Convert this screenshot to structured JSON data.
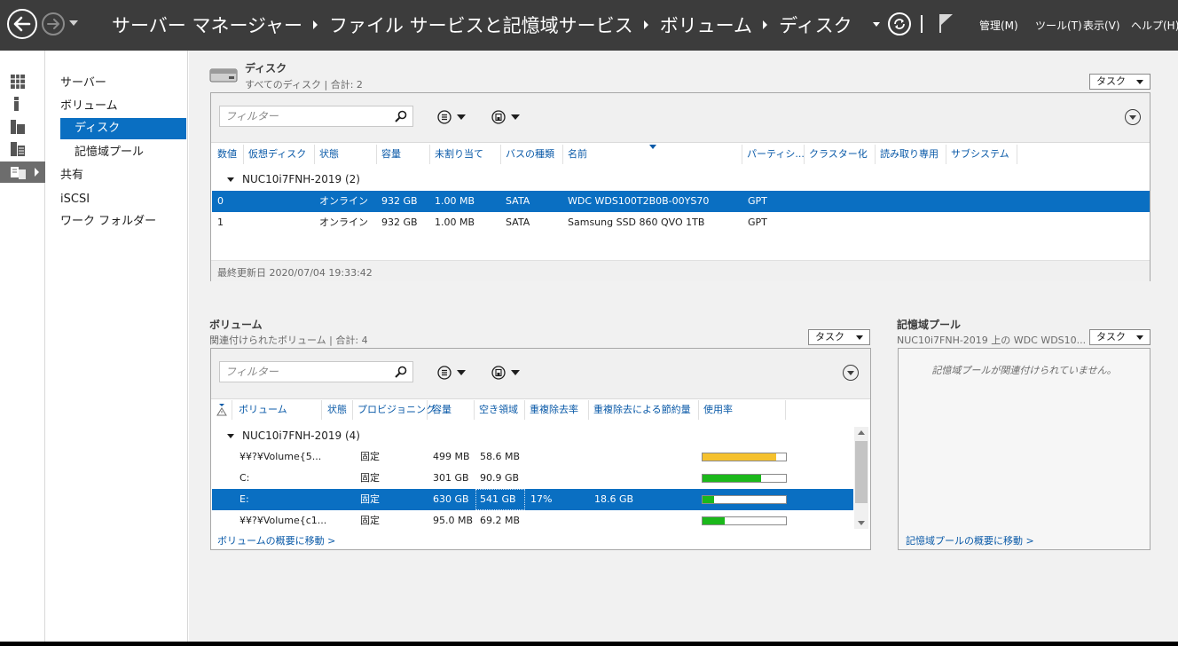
{
  "header": {
    "breadcrumbs": [
      "サーバー マネージャー",
      "ファイル サービスと記憶域サービス",
      "ボリューム",
      "ディスク"
    ],
    "menus": [
      "管理(M)",
      "ツール(T)",
      "表示(V)",
      "ヘルプ(H)"
    ]
  },
  "tree": {
    "items": [
      "サーバー",
      "ボリューム",
      "ディスク",
      "記憶域プール",
      "共有",
      "iSCSI",
      "ワーク フォルダー"
    ]
  },
  "disks": {
    "title": "ディスク",
    "subtitle": "すべてのディスク | 合計: 2",
    "task_label": "タスク",
    "filter_placeholder": "フィルター",
    "columns": [
      "数値",
      "仮想ディスク",
      "状態",
      "容量",
      "未割り当て",
      "バスの種類",
      "名前",
      "パーティシ...",
      "クラスター化",
      "読み取り専用",
      "サブシステム"
    ],
    "group_label": "NUC10i7FNH-2019 (2)",
    "rows": [
      {
        "num": "0",
        "virtual": "",
        "state": "オンライン",
        "capacity": "932 GB",
        "unalloc": "1.00 MB",
        "bus": "SATA",
        "name": "WDC  WDS100T2B0B-00YS70",
        "partition": "GPT"
      },
      {
        "num": "1",
        "virtual": "",
        "state": "オンライン",
        "capacity": "932 GB",
        "unalloc": "1.00 MB",
        "bus": "SATA",
        "name": "Samsung SSD 860 QVO 1TB",
        "partition": "GPT"
      }
    ],
    "footer": "最終更新日 2020/07/04 19:33:42"
  },
  "volumes": {
    "title": "ボリューム",
    "subtitle": "関連付けられたボリューム | 合計: 4",
    "task_label": "タスク",
    "filter_placeholder": "フィルター",
    "columns": [
      "ボリューム",
      "状態",
      "プロビジョニング",
      "容量",
      "空き領域",
      "重複除去率",
      "重複除去による節約量",
      "使用率"
    ],
    "group_label": "NUC10i7FNH-2019 (4)",
    "rows": [
      {
        "volume": "¥¥?¥Volume{5...",
        "state": "",
        "provisioning": "固定",
        "capacity": "499 MB",
        "free": "58.6 MB",
        "dedup_rate": "",
        "dedup_saved": "",
        "usage": 0.88,
        "usage_color": "#f5c12e"
      },
      {
        "volume": "C:",
        "state": "",
        "provisioning": "固定",
        "capacity": "301 GB",
        "free": "90.9 GB",
        "dedup_rate": "",
        "dedup_saved": "",
        "usage": 0.7,
        "usage_color": "#1bb81b"
      },
      {
        "volume": "E:",
        "state": "",
        "provisioning": "固定",
        "capacity": "630 GB",
        "free": "541 GB",
        "dedup_rate": "17%",
        "dedup_saved": "18.6 GB",
        "usage": 0.14,
        "usage_color": "#1bb81b"
      },
      {
        "volume": "¥¥?¥Volume{c1...",
        "state": "",
        "provisioning": "固定",
        "capacity": "95.0 MB",
        "free": "69.2 MB",
        "dedup_rate": "",
        "dedup_saved": "",
        "usage": 0.27,
        "usage_color": "#1bb81b"
      }
    ],
    "footer_link": "ボリュームの概要に移動 >"
  },
  "storage_pool": {
    "title": "記憶域プール",
    "subtitle": "NUC10i7FNH-2019 上の WDC  WDS10...",
    "task_label": "タスク",
    "empty_message": "記憶域プールが関連付けられていません。",
    "footer_link": "記憶域プールの概要に移動 >"
  },
  "colors": {
    "header_bg": "#3c3c3c",
    "selection": "#0a6fc2",
    "link": "#0a5aa8"
  }
}
